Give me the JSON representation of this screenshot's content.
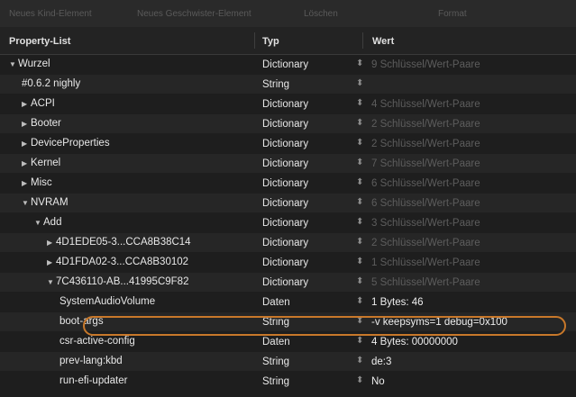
{
  "toolbar": {
    "new_child": "Neues Kind-Element",
    "new_sibling": "Neues Geschwister-Element",
    "delete": "Löschen",
    "format": "Format"
  },
  "header": {
    "col_key": "Property-List",
    "col_type": "Typ",
    "col_value": "Wert"
  },
  "rows": [
    {
      "key": "Wurzel",
      "toggle": "▼",
      "type": "Dictionary",
      "value": "9 Schlüssel/Wert-Paare"
    },
    {
      "key": "#0.6.2 nighly",
      "toggle": "",
      "type": "String",
      "value": ""
    },
    {
      "key": "ACPI",
      "toggle": "▶",
      "type": "Dictionary",
      "value": "4 Schlüssel/Wert-Paare"
    },
    {
      "key": "Booter",
      "toggle": "▶",
      "type": "Dictionary",
      "value": "2 Schlüssel/Wert-Paare"
    },
    {
      "key": "DeviceProperties",
      "toggle": "▶",
      "type": "Dictionary",
      "value": "2 Schlüssel/Wert-Paare"
    },
    {
      "key": "Kernel",
      "toggle": "▶",
      "type": "Dictionary",
      "value": "7 Schlüssel/Wert-Paare"
    },
    {
      "key": "Misc",
      "toggle": "▶",
      "type": "Dictionary",
      "value": "6 Schlüssel/Wert-Paare"
    },
    {
      "key": "NVRAM",
      "toggle": "▼",
      "type": "Dictionary",
      "value": "6 Schlüssel/Wert-Paare"
    },
    {
      "key": "Add",
      "toggle": "▼",
      "type": "Dictionary",
      "value": "3 Schlüssel/Wert-Paare"
    },
    {
      "key": "4D1EDE05-3...CCA8B38C14",
      "toggle": "▶",
      "type": "Dictionary",
      "value": "2 Schlüssel/Wert-Paare"
    },
    {
      "key": "4D1FDA02-3...CCA8B30102",
      "toggle": "▶",
      "type": "Dictionary",
      "value": "1 Schlüssel/Wert-Paare"
    },
    {
      "key": "7C436110-AB...41995C9F82",
      "toggle": "▼",
      "type": "Dictionary",
      "value": "5 Schlüssel/Wert-Paare"
    },
    {
      "key": "SystemAudioVolume",
      "toggle": "",
      "type": "Daten",
      "value": "1 Bytes: 46"
    },
    {
      "key": "boot-args",
      "toggle": "",
      "type": "String",
      "value": "-v keepsyms=1 debug=0x100"
    },
    {
      "key": "csr-active-config",
      "toggle": "",
      "type": "Daten",
      "value": "4 Bytes: 00000000"
    },
    {
      "key": "prev-lang:kbd",
      "toggle": "",
      "type": "String",
      "value": "de:3"
    },
    {
      "key": "run-efi-updater",
      "toggle": "",
      "type": "String",
      "value": "No"
    }
  ],
  "stepper_glyph": "⬍",
  "colors": {
    "background": "#1e1e1e",
    "highlight_ring": "#c8782a",
    "dim_text": "#5d5d5d"
  }
}
